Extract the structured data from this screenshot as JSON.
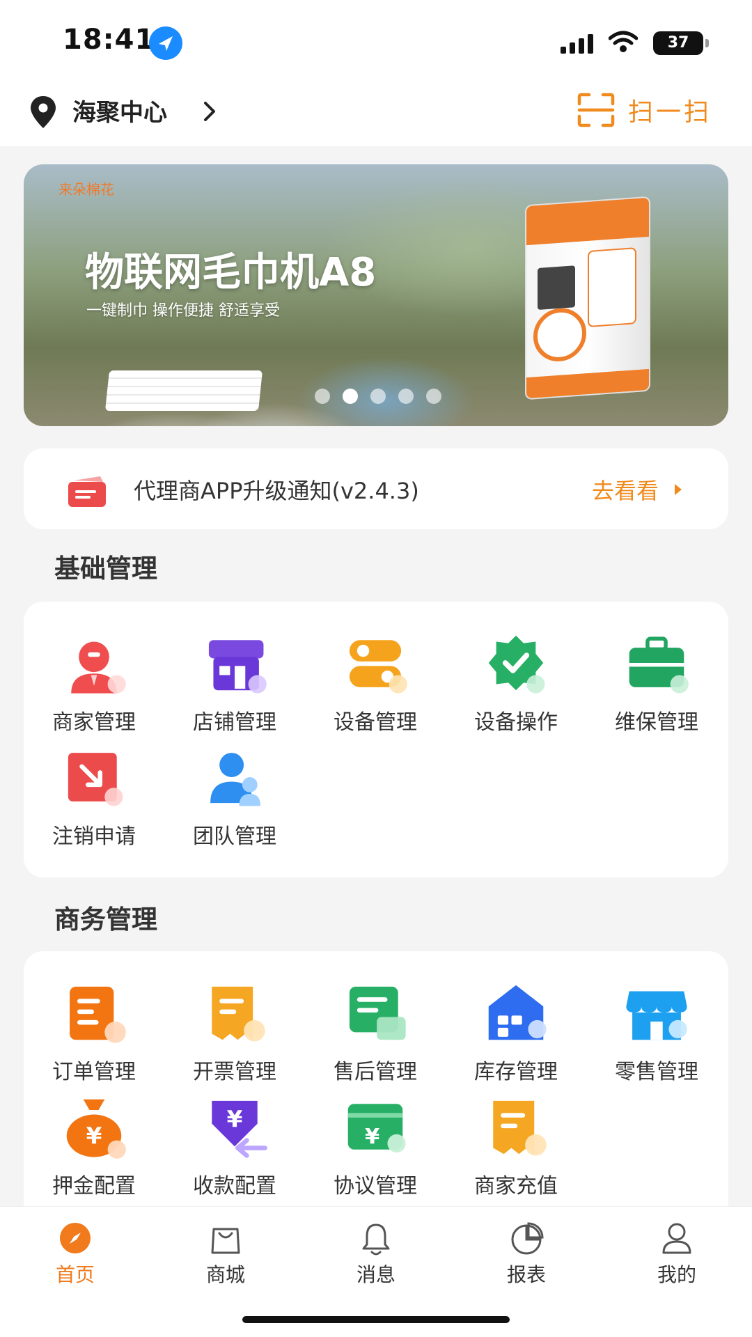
{
  "status_bar": {
    "time": "18:41",
    "battery": "37"
  },
  "header": {
    "location": "海聚中心",
    "scan_label": "扫一扫"
  },
  "banner": {
    "brand": "来朵棉花",
    "title": "物联网毛巾机A8",
    "subtitle": "一键制巾 操作便捷 舒适享受",
    "slide_count": 5,
    "active_slide": 1
  },
  "notice": {
    "text": "代理商APP升级通知(v2.4.3)",
    "link": "去看看"
  },
  "sections": [
    {
      "title": "基础管理",
      "items": [
        {
          "label": "商家管理",
          "icon": "merchant-user-icon"
        },
        {
          "label": "店铺管理",
          "icon": "store-icon"
        },
        {
          "label": "设备管理",
          "icon": "device-toggle-icon"
        },
        {
          "label": "设备操作",
          "icon": "device-check-badge-icon"
        },
        {
          "label": "维保管理",
          "icon": "toolbox-icon"
        },
        {
          "label": "注销申请",
          "icon": "cancel-request-icon"
        },
        {
          "label": "团队管理",
          "icon": "team-icon"
        }
      ]
    },
    {
      "title": "商务管理",
      "items": [
        {
          "label": "订单管理",
          "icon": "order-doc-icon"
        },
        {
          "label": "开票管理",
          "icon": "invoice-icon"
        },
        {
          "label": "售后管理",
          "icon": "after-sales-icon"
        },
        {
          "label": "库存管理",
          "icon": "warehouse-icon"
        },
        {
          "label": "零售管理",
          "icon": "retail-shop-icon"
        },
        {
          "label": "押金配置",
          "icon": "money-bag-icon"
        },
        {
          "label": "收款配置",
          "icon": "payment-collect-icon"
        },
        {
          "label": "协议管理",
          "icon": "agreement-wallet-icon"
        },
        {
          "label": "商家充值",
          "icon": "recharge-icon"
        }
      ]
    }
  ],
  "bottom_nav": [
    {
      "label": "首页",
      "icon": "home-compass-icon",
      "active": true
    },
    {
      "label": "商城",
      "icon": "shopping-bag-icon",
      "active": false
    },
    {
      "label": "消息",
      "icon": "bell-icon",
      "active": false
    },
    {
      "label": "报表",
      "icon": "pie-chart-icon",
      "active": false
    },
    {
      "label": "我的",
      "icon": "profile-icon",
      "active": false
    }
  ],
  "colors": {
    "accent": "#f08a1c",
    "nav_active": "#f07a1c",
    "background": "#f4f4f4"
  }
}
